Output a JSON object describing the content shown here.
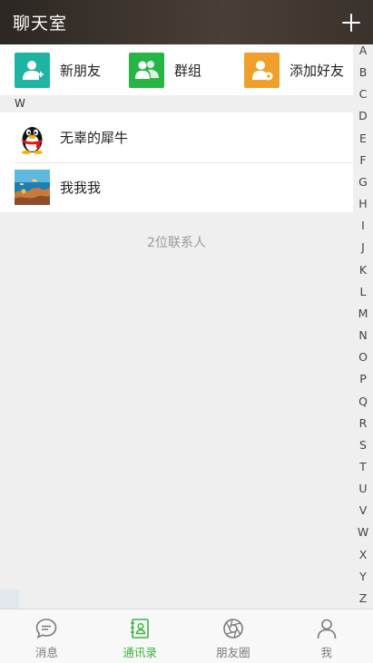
{
  "header": {
    "title": "聊天室"
  },
  "quick_actions": [
    {
      "label": "新朋友",
      "icon": "add-user-icon",
      "color": "#1fb3a3"
    },
    {
      "label": "群组",
      "icon": "group-icon",
      "color": "#27b646"
    },
    {
      "label": "添加好友",
      "icon": "add-friend-icon",
      "color": "#f0a02a"
    }
  ],
  "section_letter": "W",
  "contacts": [
    {
      "name": "无辜的犀牛",
      "avatar": "penguin-avatar"
    },
    {
      "name": "我我我",
      "avatar": "coral-reef-avatar"
    }
  ],
  "contact_count": "2位联系人",
  "index_letters": [
    "A",
    "B",
    "C",
    "D",
    "E",
    "F",
    "G",
    "H",
    "I",
    "J",
    "K",
    "L",
    "M",
    "N",
    "O",
    "P",
    "Q",
    "R",
    "S",
    "T",
    "U",
    "V",
    "W",
    "X",
    "Y",
    "Z"
  ],
  "tabs": [
    {
      "label": "消息",
      "icon": "chat-bubble-icon",
      "active": false
    },
    {
      "label": "通讯录",
      "icon": "contacts-book-icon",
      "active": true
    },
    {
      "label": "朋友圈",
      "icon": "camera-aperture-icon",
      "active": false
    },
    {
      "label": "我",
      "icon": "person-icon",
      "active": false
    }
  ],
  "colors": {
    "active_tab": "#3cb53c",
    "inactive_tab": "#7a7a7a"
  }
}
